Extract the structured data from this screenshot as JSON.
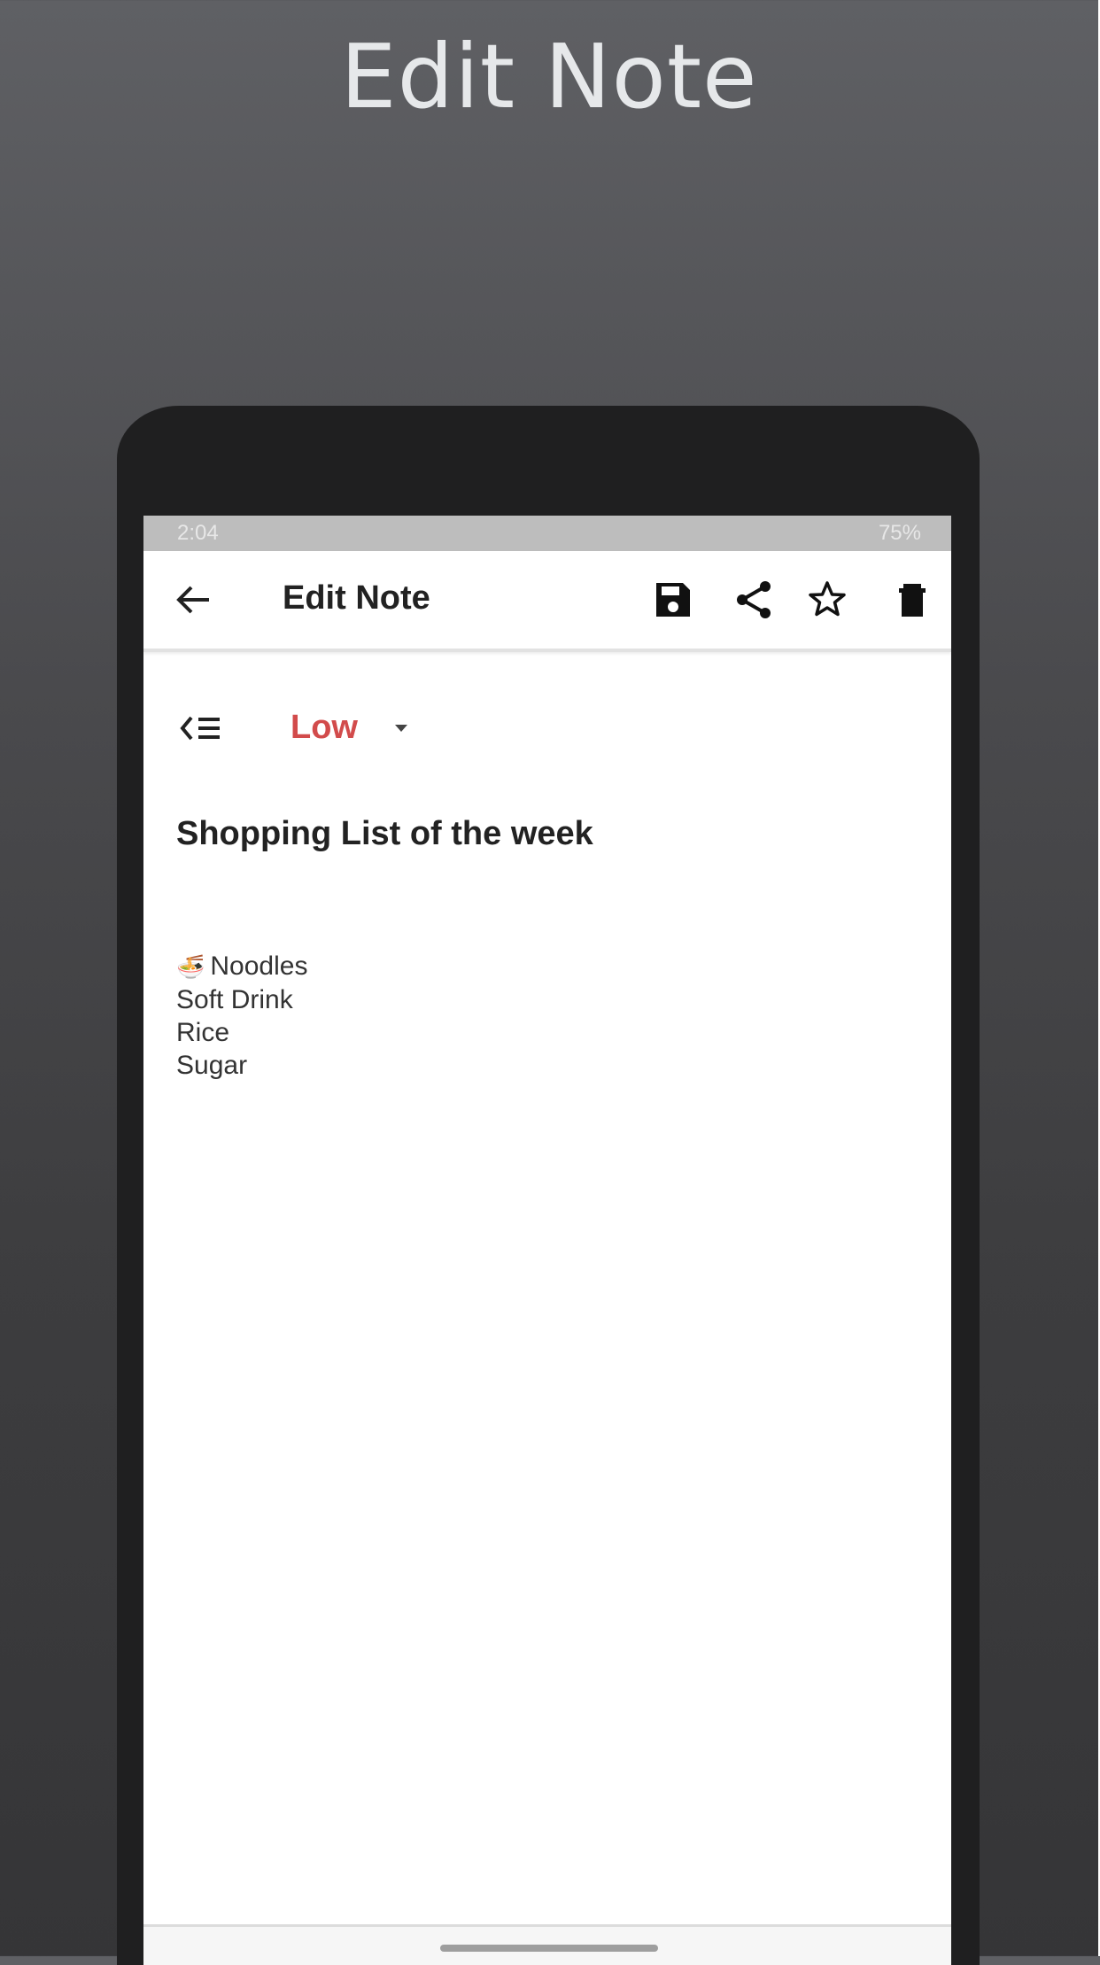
{
  "promo": {
    "title": "Edit Note"
  },
  "status_bar": {
    "time": "2:04",
    "battery": "75%"
  },
  "app_bar": {
    "title": "Edit Note",
    "icons": [
      "back-arrow-icon",
      "save-icon",
      "share-icon",
      "star-icon",
      "delete-icon"
    ]
  },
  "priority": {
    "value": "Low",
    "icon": "list-icon",
    "color": "#d24b4b"
  },
  "note": {
    "title": "Shopping List of the week",
    "items": [
      "Noodles",
      "Soft Drink",
      "Rice",
      "Sugar"
    ]
  },
  "colors": {
    "background_top": "#5f6064",
    "background_bottom": "#353537",
    "phone_frame": "#1f1f20",
    "status_bar": "#bdbdbd",
    "screen": "#ffffff"
  }
}
